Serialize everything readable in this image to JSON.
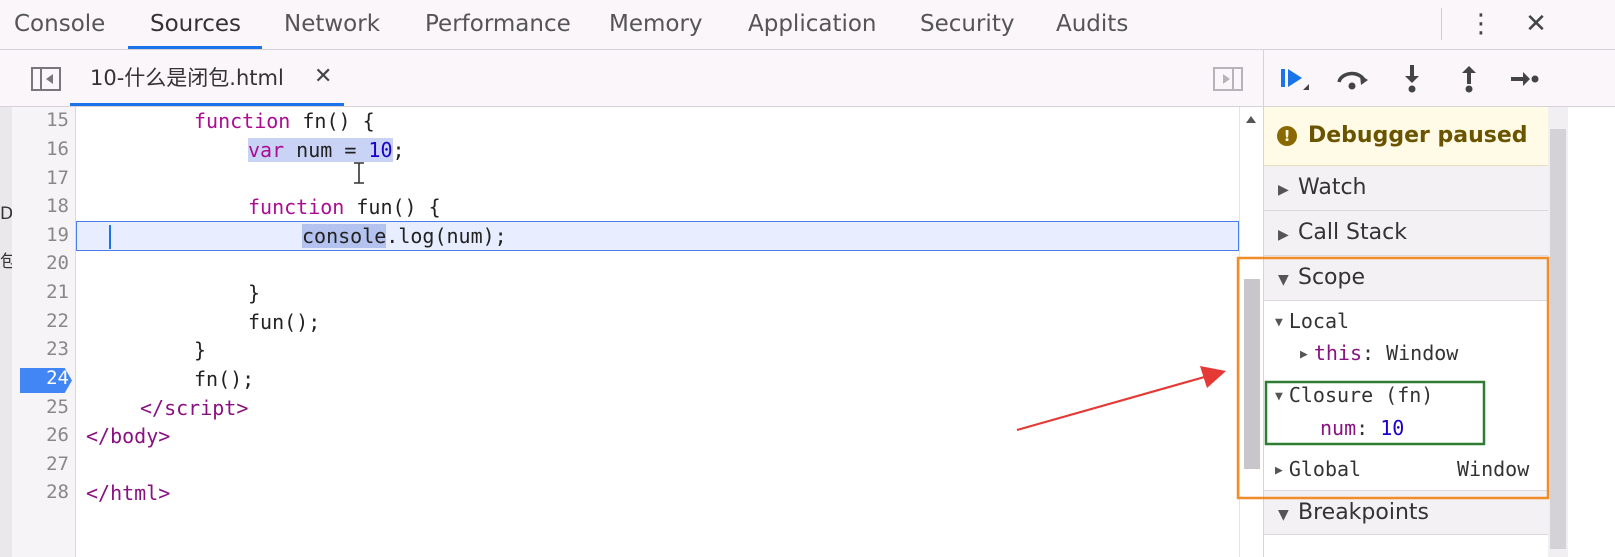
{
  "top_tabs": [
    {
      "label": "Console",
      "active": false
    },
    {
      "label": "Sources",
      "active": true
    },
    {
      "label": "Network",
      "active": false
    },
    {
      "label": "Performance",
      "active": false
    },
    {
      "label": "Memory",
      "active": false
    },
    {
      "label": "Application",
      "active": false
    },
    {
      "label": "Security",
      "active": false
    },
    {
      "label": "Audits",
      "active": false
    }
  ],
  "top_controls": {
    "more": "⋮",
    "close": "✕"
  },
  "file_tab": {
    "name": "10-什么是闭包.html",
    "close": "✕"
  },
  "icons": {
    "navigator_toggle": "toggle-navigator-icon",
    "debugger_toggle": "toggle-debugger-icon",
    "resume": "resume-icon",
    "step_over": "step-over-icon",
    "step_into": "step-into-icon",
    "step_out": "step-out-icon",
    "step": "step-icon"
  },
  "left_strip": [
    "D",
    "包"
  ],
  "code": {
    "paused_line": "24",
    "current_line": "19",
    "line_numbers": [
      "15",
      "16",
      "17",
      "18",
      "19",
      "20",
      "21",
      "22",
      "23",
      "24",
      "25",
      "26",
      "27",
      "28"
    ]
  },
  "debugger": {
    "paused_icon": "!",
    "paused_label": "Debugger paused",
    "watch": "Watch",
    "call_stack": "Call Stack",
    "scope": "Scope",
    "local": "Local",
    "this_key": "this",
    "this_value": "Window",
    "closure": "Closure (fn)",
    "num_key": "num",
    "num_value": "10",
    "global": "Global",
    "global_value": "Window",
    "breakpoints": "Breakpoints"
  },
  "colors": {
    "accent": "#1a73e8",
    "annotation_orange": "#f28c28",
    "annotation_green": "#2e7d32",
    "annotation_arrow": "#e53935"
  }
}
